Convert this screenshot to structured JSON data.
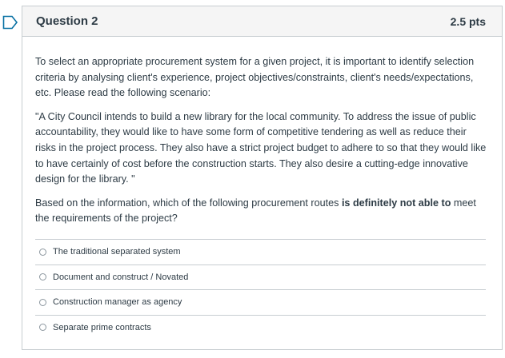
{
  "question": {
    "title": "Question 2",
    "points": "2.5 pts",
    "intro": "To select an appropriate procurement system for a given project, it is important to identify selection criteria by analysing client's experience, project objectives/constraints, client's needs/expectations, etc. Please read the following scenario:",
    "scenario": "\"A City Council intends to build a new library for the local community. To address the issue of public accountability, they would like to have some form of competitive tendering as well as reduce their risks in the project process. They also have a strict project budget to adhere to so that they would like to have certainly of cost before the construction starts. They also desire a cutting-edge innovative design for the library. \"",
    "prompt_before": "Based on the information, which of the following procurement routes ",
    "prompt_bold": "is definitely not able to",
    "prompt_after": " meet the requirements of the project?"
  },
  "answers": [
    {
      "label": "The traditional separated system"
    },
    {
      "label": "Document and construct / Novated"
    },
    {
      "label": "Construction manager as agency"
    },
    {
      "label": "Separate prime contracts"
    }
  ],
  "colors": {
    "flag": "#0770a3",
    "border": "#c7cdd1",
    "header_bg": "#f5f5f5",
    "text": "#2d3b45"
  },
  "icons": {
    "flag": "bookmark-flag-icon"
  }
}
